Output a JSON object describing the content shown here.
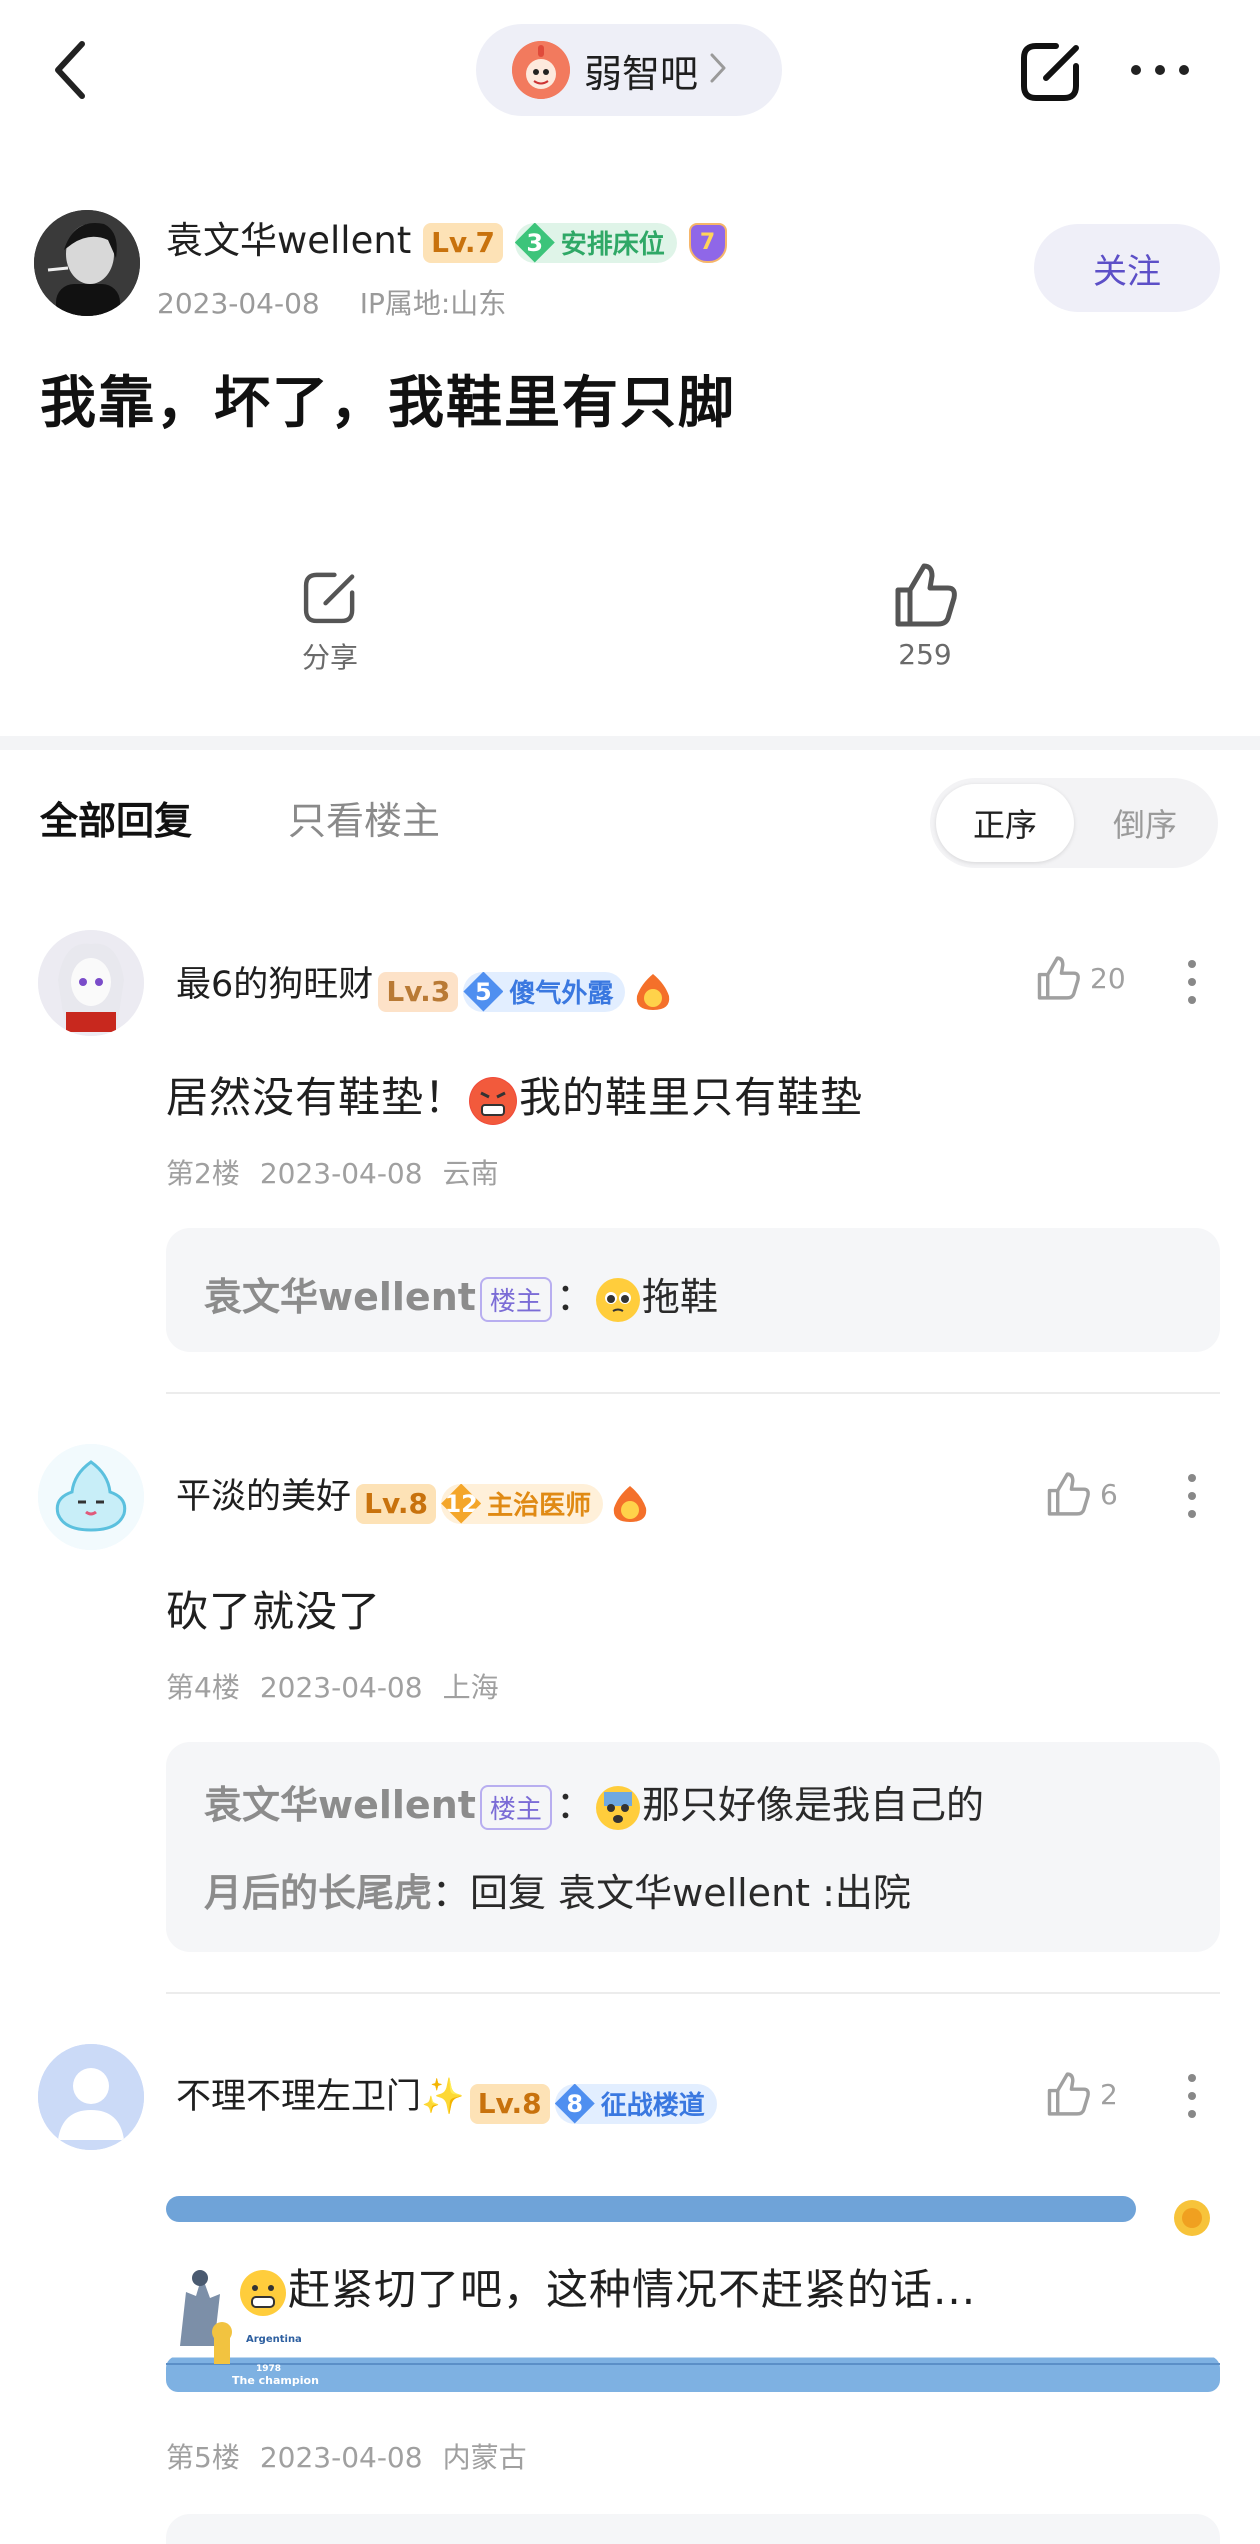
{
  "top_bar": {
    "forum_name": "弱智吧"
  },
  "op": {
    "username": "袁文华wellent",
    "level": "Lv.7",
    "title_level": "3",
    "title": "安排床位",
    "vip_level": "7",
    "date": "2023-04-08",
    "ip": "IP属地:山东",
    "follow_label": "关注",
    "post_title": "我靠，坏了，我鞋里有只脚",
    "share_label": "分享",
    "like_count": "259"
  },
  "tabs": {
    "all": "全部回复",
    "op_only": "只看楼主",
    "sort_asc": "正序",
    "sort_desc": "倒序"
  },
  "comments": [
    {
      "username": "最6的狗旺财",
      "level": "Lv.3",
      "title_level": "5",
      "title": "傻气外露",
      "likes": "20",
      "text_a": "居然没有鞋垫！",
      "text_b": "我的鞋里只有鞋垫",
      "floor": "第2楼",
      "date": "2023-04-08",
      "location": "云南",
      "replies": [
        {
          "name": "袁文华wellent",
          "tag": "楼主",
          "sep": "：",
          "text": "拖鞋"
        }
      ]
    },
    {
      "username": "平淡的美好",
      "level": "Lv.8",
      "title_level": "12",
      "title": "主治医师",
      "likes": "6",
      "text_a": "砍了就没了",
      "floor": "第4楼",
      "date": "2023-04-08",
      "location": "上海",
      "replies": [
        {
          "name": "袁文华wellent",
          "tag": "楼主",
          "sep": "：",
          "text": "那只好像是我自己的"
        },
        {
          "name": "月后的长尾虎",
          "sep": "：",
          "text": "回复 袁文华wellent :出院"
        }
      ]
    },
    {
      "username": "不理不理左卫门",
      "sparkle": "✨",
      "level": "Lv.8",
      "title_level": "8",
      "title": "征战楼道",
      "likes": "2",
      "text_a": "赶紧切了吧，这种情况不赶紧的话...",
      "bubble_caption_1": "Argentina",
      "bubble_caption_2": "1978",
      "bubble_caption_3": "The champion",
      "floor": "第5楼",
      "date": "2023-04-08",
      "location": "内蒙古"
    }
  ]
}
